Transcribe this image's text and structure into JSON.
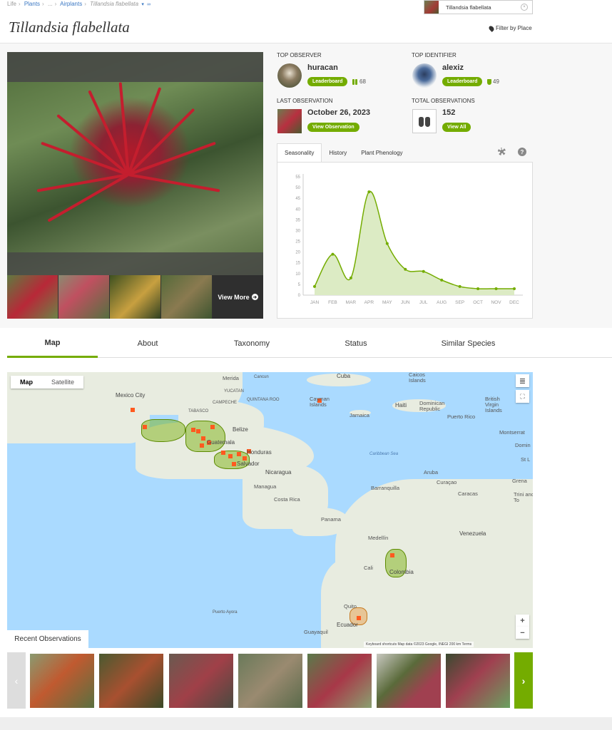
{
  "breadcrumb": {
    "items": [
      "Life",
      "Plants",
      "...",
      "Airplants"
    ],
    "current": "Tillandsia flabellata"
  },
  "title": "Tillandsia flabellata",
  "search": {
    "value": "Tillandsia flabellata",
    "clear_icon": "x-circle-icon"
  },
  "filter": {
    "label": "Filter by Place"
  },
  "stats": {
    "top_observer": {
      "label": "TOP OBSERVER",
      "name": "huracan",
      "button": "Leaderboard",
      "count": "68"
    },
    "top_identifier": {
      "label": "TOP IDENTIFIER",
      "name": "alexiz",
      "button": "Leaderboard",
      "count": "49"
    },
    "last_observation": {
      "label": "LAST OBSERVATION",
      "date": "October 26, 2023",
      "button": "View Observation"
    },
    "total_observations": {
      "label": "TOTAL OBSERVATIONS",
      "count": "152",
      "button": "View All"
    }
  },
  "photos": {
    "view_more": "View More"
  },
  "chart_tabs": [
    "Seasonality",
    "History",
    "Plant Phenology"
  ],
  "chart_data": {
    "type": "area",
    "title": "",
    "categories": [
      "JAN",
      "FEB",
      "MAR",
      "APR",
      "MAY",
      "JUN",
      "JUL",
      "AUG",
      "SEP",
      "OCT",
      "NOV",
      "DEC"
    ],
    "series": [
      {
        "values": [
          4,
          19,
          8,
          48,
          24,
          12,
          11,
          7,
          4,
          3,
          3,
          3
        ]
      }
    ],
    "yticks": [
      0,
      5,
      10,
      15,
      20,
      25,
      30,
      35,
      40,
      45,
      50,
      55
    ],
    "ylim": [
      0,
      55
    ],
    "grid": false,
    "colors": {
      "line": "#74ac00",
      "fill": "#dcebc4"
    }
  },
  "nav_tabs": [
    "Map",
    "About",
    "Taxonomy",
    "Status",
    "Similar Species"
  ],
  "map": {
    "toggle": [
      "Map",
      "Satellite"
    ],
    "zoom_in": "+",
    "zoom_out": "−",
    "labels": {
      "merida": "Merida",
      "cancun": "Cancun",
      "cuba": "Cuba",
      "caicos": "Caicos Islands",
      "mexico_city": "Mexico City",
      "yucatan": "YUCATAN",
      "quintana": "QUINTANA ROO",
      "campeche": "CAMPECHE",
      "cayman": "Cayman Islands",
      "haiti": "Haiti",
      "dominican": "Dominican Republic",
      "puerto_rico": "Puerto Rico",
      "british": "British Virgin Islands",
      "jamaica": "Jamaica",
      "tabasco": "TABASCO",
      "belize": "Belize",
      "guatemala": "Guatemala",
      "honduras": "Honduras",
      "salvador": "Salvador",
      "caribbean": "Caribbean Sea",
      "montserrat": "Montserrat",
      "domin": "Domin",
      "stl": "St L",
      "nicaragua": "Nicaragua",
      "managua": "Managua",
      "aruba": "Aruba",
      "curacao": "Curaçao",
      "grena": "Grena",
      "barranquilla": "Barranquilla",
      "caracas": "Caracas",
      "trini": "Trini and To",
      "costa_rica": "Costa Rica",
      "panama": "Panama",
      "medellin": "Medellín",
      "venezuela": "Venezuela",
      "colombia": "Colombia",
      "cali": "Cali",
      "quito": "Quito",
      "ecuador": "Ecuador",
      "guayaquil": "Guayaquil",
      "puerto_ayora": "Puerto Ayora"
    },
    "attribution": "Keyboard shortcuts    Map data ©2023 Google, INEGI    200 km    Terms"
  },
  "recent": {
    "title": "Recent Observations"
  }
}
